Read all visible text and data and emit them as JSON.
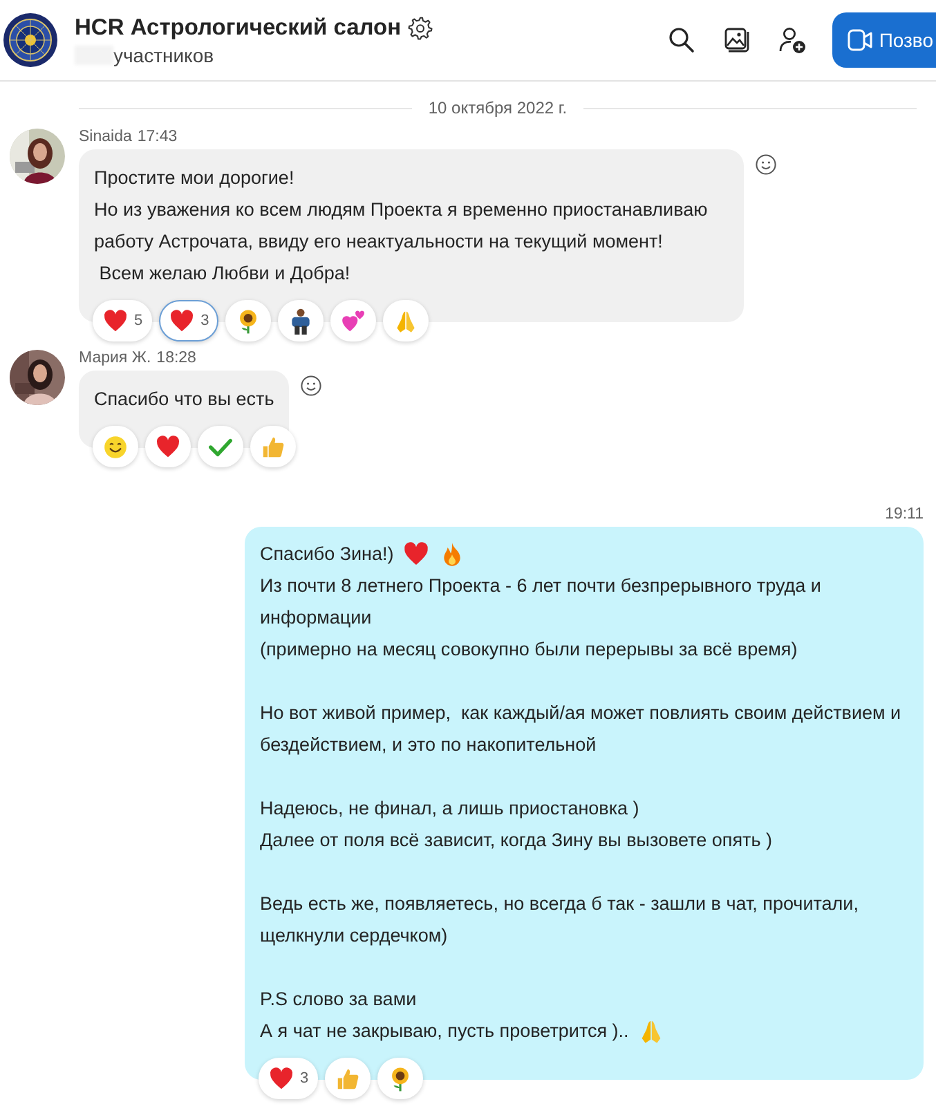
{
  "header": {
    "title": "HCR Астрологический салон",
    "members": "участников",
    "call_button": "Позво"
  },
  "date_separator": "10 октября 2022 г.",
  "messages": [
    {
      "kind": "incoming",
      "sender": "Sinaida",
      "time": "17:43",
      "blocks": [
        {
          "lines": [
            {
              "text": "Простите мои дорогие!"
            },
            {
              "text": "Но из уважения ко всем людям Проекта я временно приостанавливаю работу Астрочата, ввиду его неактуальности на текущий момент!"
            },
            {
              "text": " Всем желаю Любви и Добра!"
            }
          ]
        }
      ],
      "reactions": [
        {
          "kind": "heart",
          "count": "5",
          "selected": false
        },
        {
          "kind": "heart",
          "count": "3",
          "selected": true
        },
        {
          "kind": "sunflower",
          "selected": false
        },
        {
          "kind": "person",
          "selected": false
        },
        {
          "kind": "two-hearts",
          "selected": false
        },
        {
          "kind": "pray",
          "selected": false
        }
      ]
    },
    {
      "kind": "incoming",
      "sender": "Мария Ж.",
      "time": "18:28",
      "blocks": [
        {
          "lines": [
            {
              "text": "Спасибо что вы есть"
            }
          ]
        }
      ],
      "reactions": [
        {
          "kind": "smile",
          "selected": false
        },
        {
          "kind": "heart",
          "selected": false
        },
        {
          "kind": "check",
          "selected": false
        },
        {
          "kind": "thumbs-up",
          "selected": false
        }
      ]
    },
    {
      "kind": "outgoing",
      "time": "19:11",
      "blocks": [
        {
          "lines": [
            {
              "text": "Спасибо Зина!)",
              "icons": [
                {
                  "kind": "heart"
                },
                {
                  "kind": "fire"
                }
              ]
            },
            {
              "text": "Из почти 8 летнего Проекта - 6 лет почти безпрерывного труда и информации"
            },
            {
              "text": "(примерно на месяц совокупно были перерывы за всё время)"
            }
          ]
        },
        {
          "lines": [
            {
              "text": "Но вот живой пример,  как каждый/ая может повлиять своим действием и бездействием, и это по накопительной"
            }
          ]
        },
        {
          "lines": [
            {
              "text": "Надеюсь, не финал, а лишь приостановка )"
            },
            {
              "text": "Далее от поля всё зависит, когда Зину вы вызовете опять )"
            }
          ]
        },
        {
          "lines": [
            {
              "text": "Ведь есть же, появляетесь, но всегда б так - зашли в чат, прочитали, щелкнули сердечком)"
            }
          ]
        },
        {
          "lines": [
            {
              "text": "P.S слово за вами"
            },
            {
              "text": "А я чат не закрываю, пусть проветрится )..",
              "icons": [
                {
                  "kind": "pray"
                }
              ]
            }
          ]
        }
      ],
      "reactions": [
        {
          "kind": "heart",
          "count": "3",
          "selected": false
        },
        {
          "kind": "thumbs-up",
          "selected": false
        },
        {
          "kind": "sunflower",
          "selected": false
        }
      ]
    }
  ]
}
